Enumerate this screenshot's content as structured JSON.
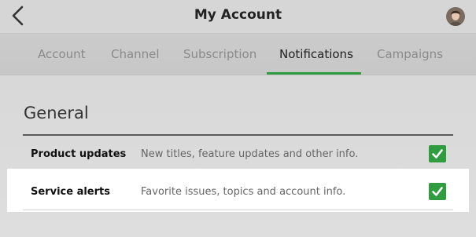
{
  "header": {
    "title": "My Account",
    "back_icon": "chevron-left-icon",
    "avatar_icon": "user-avatar"
  },
  "tabs": [
    {
      "label": "Account",
      "active": false
    },
    {
      "label": "Channel",
      "active": false
    },
    {
      "label": "Subscription",
      "active": false
    },
    {
      "label": "Notifications",
      "active": true
    },
    {
      "label": "Campaigns",
      "active": false
    }
  ],
  "section": {
    "title": "General",
    "rows": [
      {
        "label": "Product updates",
        "description": "New titles, feature updates and other info.",
        "checked": true
      },
      {
        "label": "Service alerts",
        "description": "Favorite issues, topics and account info.",
        "checked": true
      }
    ]
  },
  "colors": {
    "accent": "#2e9c3f",
    "background": "#d9d9d9",
    "highlight": "#ffffff"
  }
}
